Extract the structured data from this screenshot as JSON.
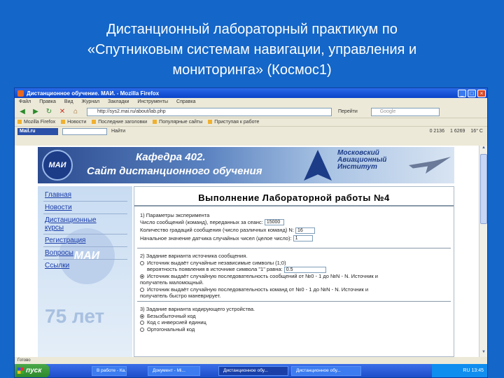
{
  "slide": {
    "title_lines": [
      "Дистанционный лабораторный практикум по",
      "«Спутниковым системам навигации, управления и",
      "мониторинга» (Космос1)"
    ]
  },
  "window": {
    "title": "Дистанционное обучение. МАИ. - Mozilla Firefox",
    "controls": [
      "_",
      "□",
      "×"
    ]
  },
  "menu": [
    "Файл",
    "Правка",
    "Вид",
    "Журнал",
    "Закладки",
    "Инструменты",
    "Справка"
  ],
  "nav": {
    "url": "http://sys2.mai.ru/about/lab.php",
    "go_label": "Перейти",
    "search_placeholder": "Google"
  },
  "bookmarks": [
    "Mozilla Firefox",
    "Новости",
    "Последние заголовки",
    "Популярные сайты",
    "Приступая к работе"
  ],
  "toolbar2": {
    "logo": "Mail.ru",
    "button": "Найти",
    "stats": [
      "0 2136",
      "1 6269",
      "16° C"
    ]
  },
  "banner": {
    "logo": "МАИ",
    "line1": "Кафедра 402.",
    "line2": "Сайт дистанционного обучения",
    "institute_lines": [
      "Московский",
      "Авиационный",
      "Институт"
    ]
  },
  "sidebar": {
    "links": [
      "Главная",
      "Новости",
      "Дистанционные",
      "курсы",
      "Регистрация",
      "Вопросы",
      "Ссылки"
    ],
    "emblem": "МАИ",
    "years": "75 лет"
  },
  "main": {
    "heading": "Выполнение Лабораторной работы №4",
    "section1": {
      "title": "1) Параметры эксперимента",
      "rows": [
        {
          "label": "Число сообщений (команд), переданных за сеанс:",
          "value": "15000"
        },
        {
          "label": "Количество градаций сообщения (число различных команд) N:",
          "value": "16"
        },
        {
          "label": "Начальное значение датчика случайных чисел (целое число):",
          "value": "1"
        }
      ]
    },
    "section2": {
      "title": "2) Задание варианта источника сообщения.",
      "options": [
        {
          "text": "Источник выдаёт случайные независимые символы (1;0)",
          "checked": false
        },
        {
          "text": "вероятность появления в источнике символа \"1\" равна:",
          "value": "0.5"
        },
        {
          "text": "Источник выдаёт случайную последовательность сообщений от №0 - 1 до №N - N. Источник и",
          "checked": true
        },
        {
          "text": "получатель маломощный."
        },
        {
          "text": "Источник выдаёт случайную последовательность команд от №0 - 1 до №N - N. Источник и",
          "checked": false
        },
        {
          "text": "получатель быстро маневрирует."
        }
      ]
    },
    "section3": {
      "title": "3) Задание варианта кодирующего устройства.",
      "options": [
        {
          "text": "Безызбыточный код",
          "checked": true
        },
        {
          "text": "Код с инверсией единиц",
          "checked": false
        },
        {
          "text": "Ортогональный код",
          "checked": false
        }
      ]
    }
  },
  "status": "Готово",
  "taskbar": {
    "start": "пуск",
    "tasks": [
      "В работе - Ка...",
      "Документ - Mi...",
      "Дистанционное обу...",
      "Дистанционное обу..."
    ],
    "clock": "RU  13:45"
  }
}
